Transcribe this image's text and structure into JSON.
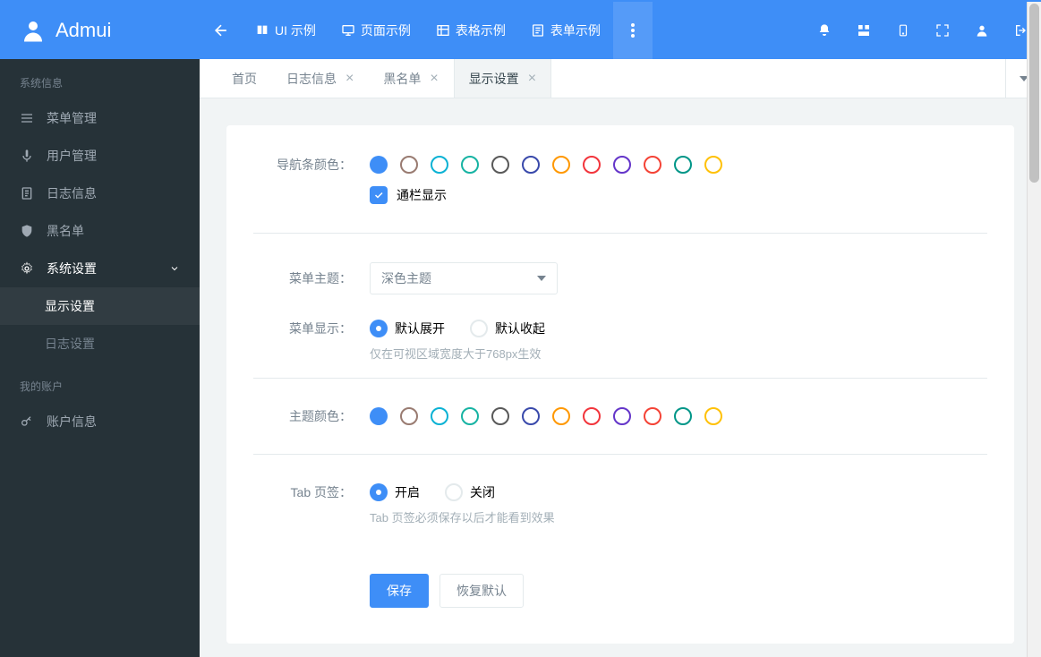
{
  "brand": {
    "name": "Admui"
  },
  "topnav": {
    "items": [
      {
        "label": "UI 示例"
      },
      {
        "label": "页面示例"
      },
      {
        "label": "表格示例"
      },
      {
        "label": "表单示例"
      }
    ]
  },
  "sidebar": {
    "group1": {
      "title": "系统信息"
    },
    "items": [
      {
        "label": "菜单管理"
      },
      {
        "label": "用户管理"
      },
      {
        "label": "日志信息"
      },
      {
        "label": "黑名单"
      },
      {
        "label": "系统设置"
      }
    ],
    "subitems": [
      {
        "label": "显示设置"
      },
      {
        "label": "日志设置"
      }
    ],
    "group2": {
      "title": "我的账户"
    },
    "items2": [
      {
        "label": "账户信息"
      }
    ]
  },
  "tabs": [
    {
      "label": "首页",
      "closable": false
    },
    {
      "label": "日志信息",
      "closable": true
    },
    {
      "label": "黑名单",
      "closable": true
    },
    {
      "label": "显示设置",
      "closable": true,
      "active": true
    }
  ],
  "form": {
    "navColor": {
      "label": "导航条颜色："
    },
    "fullWidth": {
      "label": "通栏显示"
    },
    "menuTheme": {
      "label": "菜单主题：",
      "value": "深色主题"
    },
    "menuDisplay": {
      "label": "菜单显示：",
      "opt1": "默认展开",
      "opt2": "默认收起",
      "hint": "仅在可视区域宽度大于768px生效"
    },
    "themeColor": {
      "label": "主题颜色："
    },
    "tabOption": {
      "label": "Tab 页签：",
      "opt1": "开启",
      "opt2": "关闭",
      "hint": "Tab 页签必须保存以后才能看到效果"
    },
    "save": "保存",
    "reset": "恢复默认"
  },
  "colors": [
    "#3e8ef7",
    "#997b71",
    "#0bb2d4",
    "#17b3a3",
    "#595959",
    "#3949ab",
    "#ff9800",
    "#f2353c",
    "#6435c9",
    "#f44336",
    "#009688",
    "#ffc107"
  ]
}
